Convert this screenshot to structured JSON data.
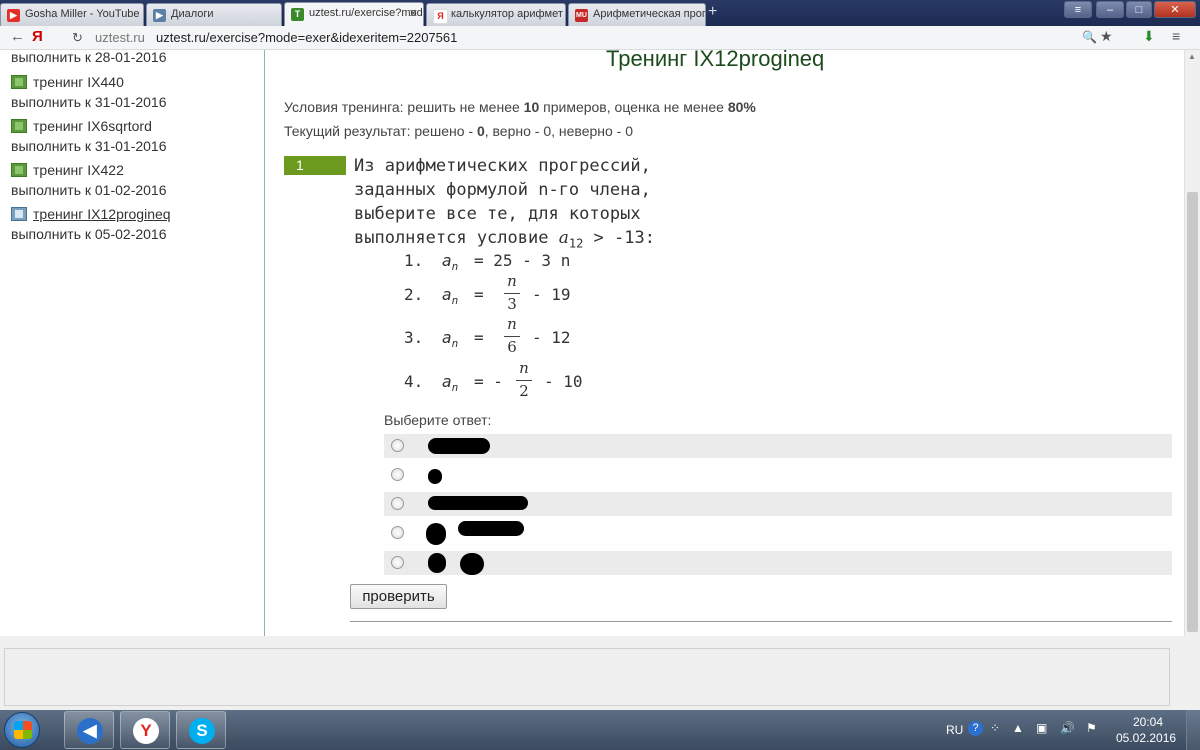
{
  "browser": {
    "tabs": [
      {
        "label": "Gosha Miller - YouTube",
        "icon": "youtube-icon"
      },
      {
        "label": "Диалоги",
        "icon": "vk-icon"
      },
      {
        "label": "uztest.ru/exercise?mode",
        "icon": "uztest-icon",
        "active": true
      },
      {
        "label": "калькулятор арифмет",
        "icon": "yandex-icon"
      },
      {
        "label": "Арифметическая прогр",
        "icon": "mu-icon"
      }
    ],
    "yandex_button": "Я",
    "address_host": "uztest.ru",
    "address_url": "uztest.ru/exercise?mode=exer&idexeritem=2207561"
  },
  "sidebar": {
    "top_date": "выполнить к 28-01-2016",
    "items": [
      {
        "title": "тренинг IX440",
        "date": "выполнить к 31-01-2016"
      },
      {
        "title": "тренинг IX6sqrtord",
        "date": "выполнить к 31-01-2016"
      },
      {
        "title": "тренинг IX422",
        "date": "выполнить к 01-02-2016"
      },
      {
        "title": "тренинг IX12progineq",
        "date": "выполнить к 05-02-2016",
        "current": true
      }
    ]
  },
  "main": {
    "title": "Тренинг IX12progineq",
    "conditions": {
      "prefix": "Условия тренинга: решить не менее ",
      "count": "10",
      "middle": " примеров, оценка не менее ",
      "percent": "80%"
    },
    "result": {
      "prefix": "Текущий результат: решено - ",
      "solved": "0",
      "rest": ", верно - 0, неверно - 0"
    },
    "question": {
      "number": "1",
      "text_lines": [
        "Из арифметических прогрессий,",
        "заданных формулой n-го члена,",
        "выберите все те, для которых",
        "выполняется условие "
      ],
      "condition_var": "a",
      "condition_sub": "12",
      "condition_rest": " > -13:",
      "options": [
        {
          "num": "1.",
          "lhs": "a",
          "sub": "n",
          "rhs": "= 25 - 3 n"
        },
        {
          "num": "2.",
          "lhs": "a",
          "sub": "n",
          "eq": "=",
          "numer": "n",
          "denom": "3",
          "tail": "- 19"
        },
        {
          "num": "3.",
          "lhs": "a",
          "sub": "n",
          "eq": "=",
          "numer": "n",
          "denom": "6",
          "tail": "- 12"
        },
        {
          "num": "4.",
          "lhs": "a",
          "sub": "n",
          "eq": "= -",
          "numer": "n",
          "denom": "2",
          "tail": "- 10"
        }
      ]
    },
    "choose_label": "Выберите ответ:",
    "answers_count": 5,
    "check_button": "проверить"
  },
  "taskbar": {
    "lang": "RU",
    "time": "20:04",
    "date": "05.02.2016",
    "apps": [
      {
        "name": "volume-app-icon",
        "color": "#2a6fc9"
      },
      {
        "name": "yandex-browser-icon",
        "color": "#e52620"
      },
      {
        "name": "skype-icon",
        "color": "#00aff0"
      }
    ]
  }
}
